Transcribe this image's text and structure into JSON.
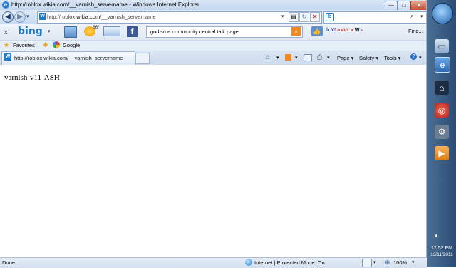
{
  "window": {
    "title": "http://roblox.wikia.com/__varnish_servername - Windows Internet Explorer",
    "minimize_label": "—",
    "maximize_label": "□",
    "close_label": "✕"
  },
  "address_bar": {
    "url_prefix": "http://roblox.",
    "url_domain": "wikia.com",
    "url_path": "/__varnish_servername",
    "search_placeholder": ""
  },
  "bing_toolbar": {
    "close_label": "x",
    "logo_text": "bing",
    "weather_temp": "66°",
    "search_query": "godisme community central talk page",
    "find_label": "Find..."
  },
  "favorites_bar": {
    "favorites_label": "Favorites",
    "google_label": "Google"
  },
  "tabs": [
    {
      "label": "http://roblox.wikia.com/__varnish_servername"
    }
  ],
  "command_bar": {
    "page_label": "Page",
    "safety_label": "Safety",
    "tools_label": "Tools"
  },
  "content": {
    "text": "varnish-v11-ASH"
  },
  "status_bar": {
    "status": "Done",
    "zone": "Internet | Protected Mode: On",
    "zoom": "100%"
  },
  "taskbar": {
    "time": "12:52 PM",
    "date": "13/11/2011"
  },
  "colors": {
    "chrome_blue": "#cadcf1",
    "bing_blue": "#1d78c8",
    "taskbar": "#2c4c73"
  }
}
